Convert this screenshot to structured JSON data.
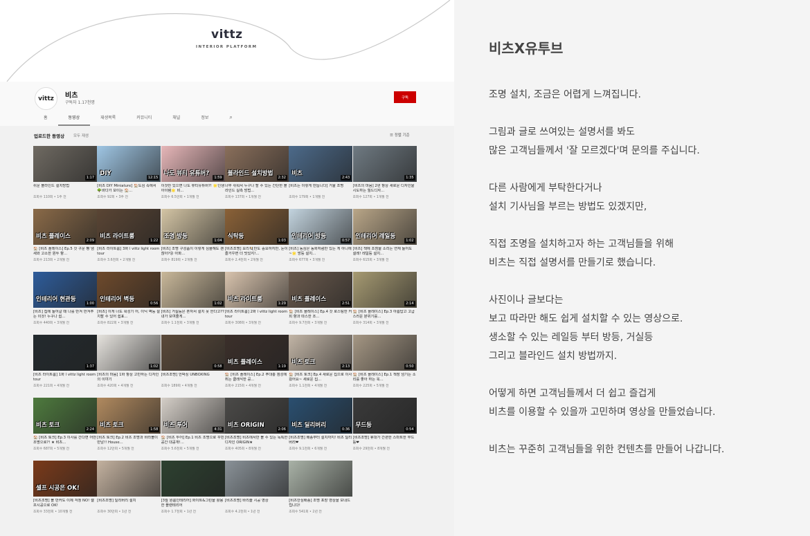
{
  "banner": {
    "brand": "vittz",
    "tagline": "INTERIOR PLATFORM"
  },
  "channel": {
    "avatar_text": "vittz",
    "name": "비츠",
    "subscribers": "구독자 1.17천명",
    "subscribe_label": "구독"
  },
  "tabs": [
    {
      "label": "홈"
    },
    {
      "label": "동영상"
    },
    {
      "label": "재생목록"
    },
    {
      "label": "커뮤니티"
    },
    {
      "label": "채널"
    },
    {
      "label": "정보"
    }
  ],
  "section": {
    "title": "업로드한 동영상",
    "play_all": "모두 재생",
    "sort_label": "정렬 기준"
  },
  "videos": [
    {
      "thumb_text": "",
      "duration": "1:17",
      "title": "쉬운 블라인드 설치방법",
      "meta": "조회수 110회 • 1주 전",
      "bg": "#6f6a62"
    },
    {
      "thumb_text": "DIY",
      "duration": "12:15",
      "title": "[비츠 DIY Miniature] 🏠도심 속에서 🌳바다가 보이는 🏠...",
      "meta": "조회수 92회 • 3주 전",
      "bg": "#9fc6e4"
    },
    {
      "thumb_text": "나도 뷰티 유튜버?",
      "duration": "1:59",
      "title": "이것만 있으면 나도 뷰티유튜버?! 🌟인생 아이템🌟 비...",
      "meta": "조회수 6.5만회 • 1개월 전",
      "bg": "#e7b7b9"
    },
    {
      "thumb_text": "블라인드 설치방법",
      "duration": "2:32",
      "title": "너무 쉬워서 누구나 할 수 있는 간단한 블라인드 실측 방법...",
      "meta": "조회수 137회 • 1개월 전",
      "bg": "#8a6f5b"
    },
    {
      "thumb_text": "비츠",
      "duration": "2:43",
      "title": "[비츠는 이렇게 만듭니다] 거울 조명",
      "meta": "조회수 179회 • 1개월 전",
      "bg": "#4c6a8a"
    },
    {
      "thumb_text": "",
      "duration": "1:35",
      "title": "[비츠의 마음] 2편 항상 새로운 디자인을 시도하는 월드디자...",
      "meta": "조회수 127회 • 1개월 전",
      "bg": "#6f7a82"
    },
    {
      "thumb_text": "비츠 플레이스",
      "duration": "2:09",
      "title": "🏠 [비츠 플레이스] Ep.5 갓 구운 빵 냄새와 고소한 원두 향...",
      "meta": "조회수 213회 • 2개월 전",
      "bg": "#8a6a48"
    },
    {
      "thumb_text": "비츠 라이트룸",
      "duration": "1:22",
      "title": "[비츠 라이트룸] 3화 l vittz light room tour",
      "meta": "조회수 3.6천회 • 2개월 전",
      "bg": "#5a4534"
    },
    {
      "thumb_text": "조명 방등",
      "duration": "1:04",
      "title": "[비츠] 조명 구성품이 이렇게 심플해도 괜찮아?😮 아파...",
      "meta": "조회수 819회 • 2개월 전",
      "bg": "#d4c5a5"
    },
    {
      "thumb_text": "식탁등",
      "duration": "1:03",
      "title": "[비츠조명] 요리🍳만도 중요하지만, 눈이 즐거우면 더 맛있지!...",
      "meta": "조회수 2.4천회 • 2개월 전",
      "bg": "#8a6137"
    },
    {
      "thumb_text": "인테리어 방등",
      "duration": "0:57",
      "title": "[비츠] 동심은 동화처럼만 있는 게 아니에~🌟 방등 설치...",
      "meta": "조회수 677회 • 3개월 전",
      "bg": "#c3d4df"
    },
    {
      "thumb_text": "인테리어 레일등",
      "duration": "1:02",
      "title": "[비츠] 책에 초점을 소리는 연재 들어도 설레! 레일등 설치...",
      "meta": "조회수 615회 • 3개월 전",
      "bg": "#b9a688"
    },
    {
      "thumb_text": "인테리어 현관등",
      "duration": "1:00",
      "title": "[비츠] 집에 들어갈 때 나를 반겨 반겨주는 이것! 누구나 쉽...",
      "meta": "조회수 440회 • 3개월 전",
      "bg": "#2e5c9a"
    },
    {
      "thumb_text": "인테리어 벽등",
      "duration": "0:56",
      "title": "[비츠] 이게 너도 확성기 어, 이닉 벽등 설치할 수 있어 쉽표...",
      "meta": "조회수 822회 • 3개월 전",
      "bg": "#6e4a2c"
    },
    {
      "thumb_text": "",
      "duration": "1:02",
      "title": "[비츠] 거실등은 혼자서 설치 못 한다고?? 내가 보여줄게...",
      "meta": "조회수 1.1천회 • 3개월 전",
      "bg": "#c9b89a"
    },
    {
      "thumb_text": "비츠 라이트룸",
      "duration": "1:29",
      "title": "[비츠 라이트룸] 2화 l vittz light room tour",
      "meta": "조회수 308회 • 3개월 전",
      "bg": "#d8c3ad"
    },
    {
      "thumb_text": "비츠 플레이스",
      "duration": "2:51",
      "title": "🏠 [비츠 플레이스] Ep.4 갓 로스팅한 커피 향과 따스한 조...",
      "meta": "조회수 9.7천회 • 3개월 전",
      "bg": "#6a5a4d"
    },
    {
      "thumb_text": "",
      "duration": "2:14",
      "title": "🏠 [비츠 플레이스] Ep.3 아름답고 고급스러운 분위기를...",
      "meta": "조회수 314회 • 3개월 전",
      "bg": "#a69a72"
    },
    {
      "thumb_text": "",
      "duration": "1:37",
      "title": "[비츠 라이트룸] 1화 l vittz light room tour",
      "meta": "조회수 221회 • 4개월 전",
      "bg": "#232a2e"
    },
    {
      "thumb_text": "",
      "duration": "1:02",
      "title": "[비츠의 마음] 1화 항상 고민하는 디자인의 이야기",
      "meta": "조회수 420회 • 4개월 전",
      "bg": "#e6e3de"
    },
    {
      "thumb_text": "",
      "duration": "0:58",
      "title": "[비츠조명] 언박싱 UNBOXING",
      "meta": "조회수 189회 • 4개월 전",
      "bg": "#5b4a3a"
    },
    {
      "thumb_text": "비츠 플레이스",
      "duration": "1:19",
      "title": "🏠 [비츠 플레이스] Ep.2 푸대충 갬성에 취는 클래식한 공...",
      "meta": "조회수 215회 • 4개월 전",
      "bg": "#3b2f2a"
    },
    {
      "thumb_text": "비츠 토크",
      "duration": "2:13",
      "title": "🏠 [비츠 토크] Ep.4 새로운 집으로 이사 왔어요~ 새로운 집...",
      "meta": "조회수 1.1천회 • 4개월 전",
      "bg": "#c2b5a6"
    },
    {
      "thumb_text": "",
      "duration": "0:50",
      "title": "🏠 [비츠 플레이스] Ep.1 책장 넘기는 소리를 좋아 하는 옥...",
      "meta": "조회수 225회 • 5개월 전",
      "bg": "#a59784"
    },
    {
      "thumb_text": "비츠 토크",
      "duration": "2:24",
      "title": "🏠 [비츠 토크] Ep.3 이사를 간다면 어떤 조명으로?! ★ 비츠...",
      "meta": "조회수 687회 • 5개월 전",
      "bg": "#4e7a3e"
    },
    {
      "thumb_text": "비츠 토크",
      "duration": "1:58",
      "title": "[비츠 토크] Ep.2 비츠 조명과 바라볼이 만남!! House...",
      "meta": "조회수 12만회 • 5개월 전",
      "bg": "#b18a5f"
    },
    {
      "thumb_text": "비츠 투어",
      "duration": "4:31",
      "title": "🏠 [비츠 투어] Ep.1 비츠 조명으로 꾸민 공간 대공개!...",
      "meta": "조회수 5.6천회 • 5개월 전",
      "bg": "#d5cfc8"
    },
    {
      "thumb_text": "비츠 ORIGIN",
      "duration": "2:06",
      "title": "[비츠조명] 비츠에서만 볼 수 있는 독특한 디자인 ORIGIN★",
      "meta": "조회수 405회 • 8개월 전",
      "bg": "#4b4a48"
    },
    {
      "thumb_text": "비츠 딜리버리",
      "duration": "0:36",
      "title": "[비츠조명] 배송부터 설치까지! 비츠 딜리버리❤",
      "meta": "조회수 9.1천회 • 6개월 전",
      "bg": "#2a4f70"
    },
    {
      "thumb_text": "무드등",
      "duration": "0:54",
      "title": "[비츠조명] 휴대가 간편한 스마트한 무드등❤",
      "meta": "조회수 29천회 • 8개월 전",
      "bg": "#3a3a3a"
    },
    {
      "thumb_text": "셀프 시공은 OK!",
      "duration": "",
      "title": "[비츠조명] 볼 만커도 이제 걱정 NO! 셀프시공으로 OK!",
      "meta": "조회수 33천회 • 10개월 전",
      "bg": "#7a3a1a"
    },
    {
      "thumb_text": "",
      "duration": "",
      "title": "[비츠조명] 딜리버리 설치",
      "meta": "조회수 30만회 • 1년 전",
      "bg": "#c4b2a0"
    },
    {
      "thumb_text": "",
      "duration": "",
      "title": "[3월 원룸인테리어] 화이트&그린을 활용한 플랜테리어",
      "meta": "조회수 1.7천회 • 1년 전",
      "bg": "#2d4130"
    },
    {
      "thumb_text": "",
      "duration": "",
      "title": "[비츠조명] 바리솔 시공 영상",
      "meta": "조회수 4.2천회 • 1년 전",
      "bg": "#8a9298"
    },
    {
      "thumb_text": "",
      "duration": "",
      "title": "[비츠안심배송] 조명 포장 영상을 보내드립니다!",
      "meta": "조회수 541회 • 2년 전",
      "bg": "#a9b2a7"
    }
  ],
  "panel": {
    "title": "비츠X유투브",
    "paragraphs": [
      [
        "조명 설치, 조금은 어렵게 느껴집니다."
      ],
      [
        "그림과 글로 쓰여있는 설명서를 봐도",
        "많은 고객님들께서 '잘 모르겠다'며 문의를 주십니다."
      ],
      [
        "다른 사람에게 부탁한다거나",
        "설치 기사님을 부르는 방법도 있겠지만,"
      ],
      [
        "직접 조명을 설치하고자 하는 고객님들을 위해",
        "비츠는 직접 설명서를 만들기로 했습니다."
      ],
      [
        "사진이나 글보다는",
        "보고 따라만 해도 쉽게 설치할 수 있는 영상으로.",
        "생소할 수 있는 레일등 부터 방등, 거실등",
        "그리고 블라인드 설치 방법까지."
      ],
      [
        "어떻게 하면 고객님들께서 더 쉽고 즐겁게",
        "비츠를 이용할 수 있을까 고민하며 영상을 만들었습니다."
      ],
      [
        "비츠는 꾸준히 고객님들을 위한 컨텐츠를 만들어 나갑니다."
      ]
    ]
  }
}
